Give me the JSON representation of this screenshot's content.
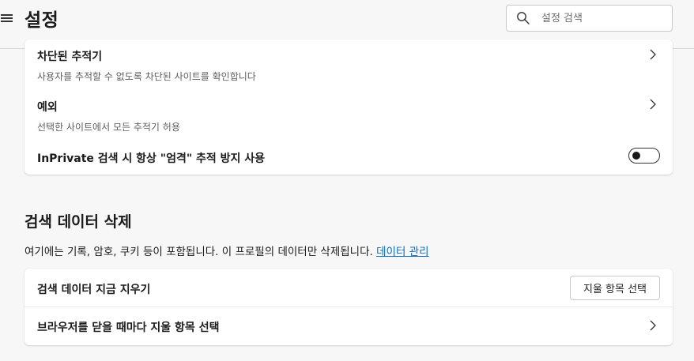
{
  "header": {
    "title": "설정",
    "search_placeholder": "설정 검색"
  },
  "tracking": {
    "blocked_trackers": {
      "title": "차단된 추적기",
      "description": "사용자를 추적할 수 없도록 차단된 사이트를 확인합니다"
    },
    "exceptions": {
      "title": "예외",
      "description": "선택한 사이트에서 모든 추적기 허용"
    },
    "inprivate_strict": {
      "title": "InPrivate 검색 시 항상 \"엄격\" 추적 방지 사용",
      "enabled": false
    }
  },
  "clear_data": {
    "section_title": "검색 데이터 삭제",
    "description": "여기에는 기록, 암호, 쿠키 등이 포함됩니다. 이 프로필의 데이터만 삭제됩니다.",
    "link_label": "데이터 관리",
    "clear_now": {
      "title": "검색 데이터 지금 지우기",
      "button_label": "지울 항목 선택"
    },
    "clear_on_close": {
      "title": "브라우저를 닫을 때마다 지울 항목 선택"
    }
  },
  "colors": {
    "link": "#0f6cbd",
    "background": "#f7f7f7",
    "card": "#ffffff"
  },
  "icons": {
    "menu": "hamburger-icon",
    "search": "search-icon",
    "chevron": "chevron-right-icon"
  }
}
